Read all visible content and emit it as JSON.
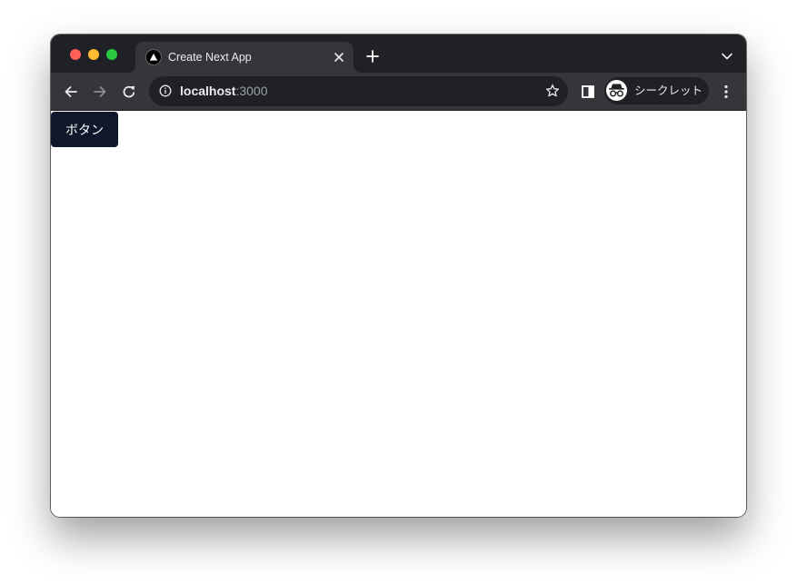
{
  "window": {
    "traffic_lights": [
      "close",
      "minimize",
      "zoom"
    ],
    "colors": {
      "close": "#ff5f57",
      "minimize": "#febc2e",
      "zoom": "#28c840"
    }
  },
  "tabstrip": {
    "active_tab": {
      "title": "Create Next App",
      "favicon": "nextjs-triangle-icon",
      "close_icon": "close-icon"
    },
    "new_tab_icon": "plus-icon",
    "tab_search_icon": "chevron-down-icon"
  },
  "toolbar": {
    "back_icon": "arrow-left-icon",
    "forward_icon": "arrow-right-icon",
    "reload_icon": "reload-icon",
    "omnibox": {
      "site_info_icon": "info-icon",
      "host": "localhost",
      "port": ":3000",
      "bookmark_icon": "star-icon"
    },
    "side_panel_icon": "side-panel-icon",
    "profile": {
      "icon": "incognito-icon",
      "label": "シークレット"
    },
    "menu_icon": "kebab-menu-icon"
  },
  "page": {
    "button_label": "ボタン",
    "button_color": "#0f172a"
  }
}
